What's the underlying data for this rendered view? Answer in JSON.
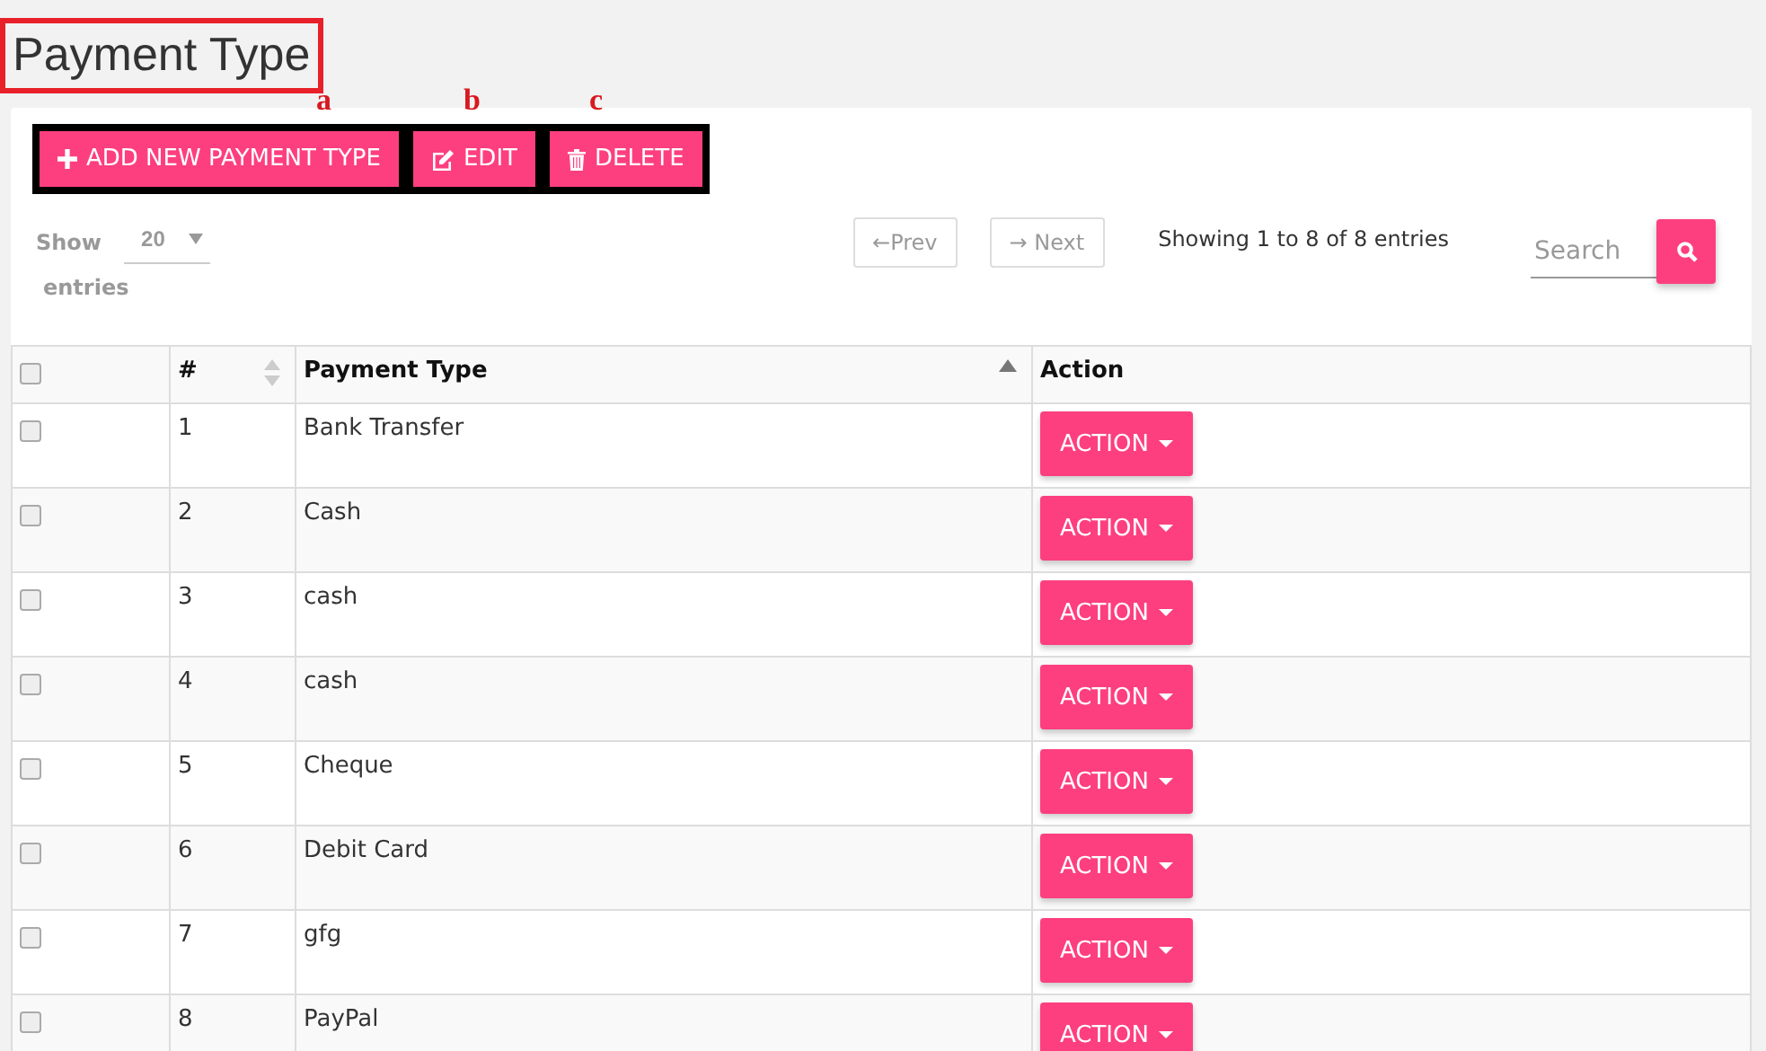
{
  "page_title": "Payment Type",
  "annotations": [
    "a",
    "b",
    "c"
  ],
  "toolbar": [
    {
      "kind": "add",
      "label": "ADD NEW PAYMENT TYPE"
    },
    {
      "kind": "edit",
      "label": "EDIT"
    },
    {
      "kind": "delete",
      "label": "DELETE"
    }
  ],
  "length_menu": {
    "show_label": "Show",
    "value": "20",
    "entries_label": "entries"
  },
  "pagination": {
    "prev": "←Prev",
    "next": "→ Next"
  },
  "info": "Showing 1 to 8 of 8 entries",
  "search": {
    "placeholder": "Search"
  },
  "table": {
    "select_all": {
      "checked": false
    },
    "columns": [
      {
        "label": "#",
        "sortable": true,
        "sorted": false
      },
      {
        "label": "Payment Type",
        "sortable": true,
        "sorted": true
      },
      {
        "label": "Action",
        "sortable": false,
        "sorted": false
      }
    ],
    "rows": [
      {
        "checked": false,
        "number": "1",
        "payment_type": "Bank Transfer",
        "action": "ACTION"
      },
      {
        "checked": false,
        "number": "2",
        "payment_type": "Cash",
        "action": "ACTION"
      },
      {
        "checked": false,
        "number": "3",
        "payment_type": "cash",
        "action": "ACTION"
      },
      {
        "checked": false,
        "number": "4",
        "payment_type": "cash",
        "action": "ACTION"
      },
      {
        "checked": false,
        "number": "5",
        "payment_type": "Cheque",
        "action": "ACTION"
      },
      {
        "checked": false,
        "number": "6",
        "payment_type": "Debit Card",
        "action": "ACTION"
      },
      {
        "checked": false,
        "number": "7",
        "payment_type": "gfg",
        "action": "ACTION"
      },
      {
        "checked": false,
        "number": "8",
        "payment_type": "PayPal",
        "action": "ACTION"
      }
    ]
  }
}
